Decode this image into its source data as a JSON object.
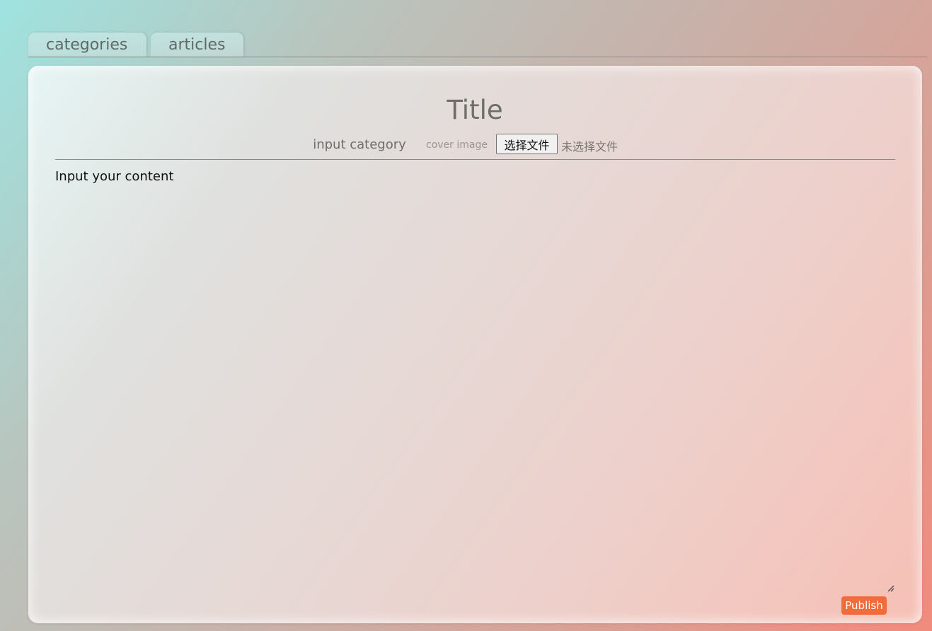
{
  "tabs": [
    {
      "label": "categories"
    },
    {
      "label": "articles"
    }
  ],
  "editor": {
    "title_placeholder": "Title",
    "category_placeholder": "input category",
    "cover_label": "cover image",
    "file_button_label": "选择文件",
    "file_status": "未选择文件",
    "content_placeholder": "Input your content",
    "publish_label": "Publish"
  },
  "colors": {
    "publish_button": "#f26b3a",
    "background_start": "#9fe3e0",
    "background_end": "#f08b7d"
  }
}
